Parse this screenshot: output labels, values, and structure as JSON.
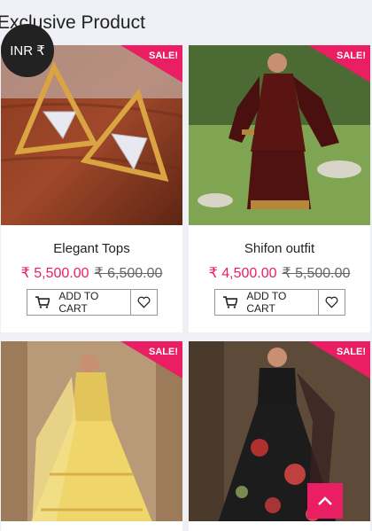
{
  "section": {
    "title": "Exclusive Product"
  },
  "currency": {
    "label": "INR ₹"
  },
  "products": [
    {
      "name": "Elegant Tops",
      "price": "₹ 5,500.00",
      "old_price": "₹ 6,500.00",
      "badge": "SALE!",
      "add_to_cart": "ADD TO CART"
    },
    {
      "name": "Shifon outfit",
      "price": "₹ 4,500.00",
      "old_price": "₹ 5,500.00",
      "badge": "SALE!",
      "add_to_cart": "ADD TO CART"
    },
    {
      "name": "",
      "price": "",
      "old_price": "",
      "badge": "SALE!",
      "add_to_cart": ""
    },
    {
      "name": "",
      "price": "",
      "old_price": "",
      "badge": "SALE!",
      "add_to_cart": ""
    }
  ],
  "colors": {
    "accent": "#e91e63",
    "background": "#eef0f5"
  }
}
